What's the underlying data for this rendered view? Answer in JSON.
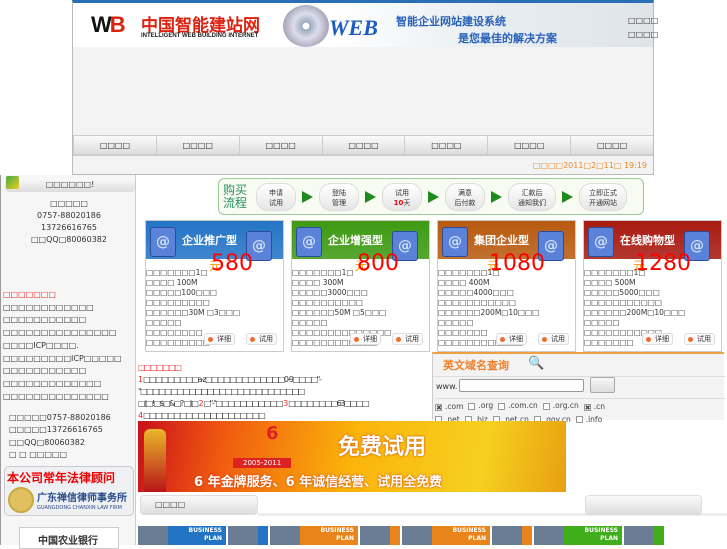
{
  "header": {
    "logo_mark": "WB",
    "logo_cn": "中国智能建站网",
    "logo_en": "INTELLIGENT WEB BUILDING INTERNET",
    "web_logo": "WEB",
    "slogan_1": "智能企业网站建设系统",
    "slogan_2": "是您最佳的解决方案",
    "top_links": [
      "□□□□",
      "□□□□"
    ],
    "nav": [
      "□□□□",
      "□□□□",
      "□□□□",
      "□□□□",
      "□□□□",
      "□□□□",
      "□□□□"
    ],
    "date": "□□□□2011□2□11□ 19:19"
  },
  "sidebar": {
    "title": "□□□□□□!",
    "contact": [
      "□□□□□",
      "0757-88020186",
      "13726616765",
      "□□QQ□80060382"
    ],
    "links": [
      "□□□□□□□",
      "□□□□□□□□□□□□",
      "□□□□□□□□□□□",
      "□□□□□□□□□□□□□□□",
      "□□□□ICP□□□□.",
      "□□□□□□□□□ICP□□□□□",
      "□□□□□□□□□□□",
      "□□□□□□□□□□□□□",
      "□□□□□□□□□□□□□□"
    ],
    "contact2": [
      "□□□□□0757-88020186",
      "□□□□□13726616765",
      "□□QQ□80060382",
      "□ □ □□□□□"
    ],
    "law_title": "本公司常年法律顾问",
    "law_firm": "广东禅信律师事务所",
    "law_firm_en": "GUANGDONG CHANXIN LAW FIRM",
    "bank": "中国农业银行"
  },
  "process": {
    "title": "购买流程",
    "steps": [
      [
        "申请",
        "试用"
      ],
      [
        "登陆",
        "管理"
      ],
      [
        "试用",
        "10",
        "天"
      ],
      [
        "满意",
        "后付款"
      ],
      [
        "汇款后",
        "通知我们"
      ],
      [
        "立即正式",
        "开通网站"
      ]
    ]
  },
  "cards": [
    {
      "name": "企业推广型",
      "color": "#2474c6",
      "currency": "元",
      "price": "580",
      "features": [
        "□□□□□□□1□",
        "□□□□ 100M",
        "□□□□□100□□□",
        "□□□□□□□□□",
        "□□□□□□30M □3□□□",
        "□□□□□",
        "□□□□□□□□",
        "□□□□□□□□□"
      ]
    },
    {
      "name": "企业增强型",
      "color": "#3d9a12",
      "currency": "元",
      "price": "800",
      "features": [
        "□□□□□□□1□",
        "□□□□ 300M",
        "□□□□□3000□□□",
        "□□□□□□□□□□",
        "□□□□□□50M □5□□□",
        "□□□□□",
        "□□□□□□□□□□□□□□",
        "□□□□□□□□□□□□"
      ]
    },
    {
      "name": "集团企业型",
      "color": "#b85a10",
      "currency": "元",
      "price": "1080",
      "features": [
        "□□□□□□□1□",
        "□□□□ 400M",
        "□□□□□4000□□□",
        "□□□□□□□□□□□",
        "□□□□□□200M□10□□□",
        "□□□□□",
        "□□□□□□□",
        "□□□□□□□□□□□□"
      ]
    },
    {
      "name": "在线购物型",
      "color": "#a81a10",
      "currency": "元",
      "price": "1280",
      "features": [
        "□□□□□□□1□",
        "□□□□ 500M",
        "□□□□□5000□□□",
        "□□□□□□□□□□□",
        "□□□□□□200M□10□□□",
        "□□□□□",
        "□□□□□□□□□□□",
        "□□□□□□□"
      ]
    }
  ],
  "card_buttons": {
    "detail": "详细",
    "trial": "试用"
  },
  "notice": {
    "title": "□□□□□□□",
    "n1": "1",
    "l1": "□□□□□□□□□a-z□□□□□□□□□□□□□0-9□□□□\"-\"□□□□□□□□□□□□□□□□□□□□□□□□□□□",
    "l2a": "□(□!□$□&□? □)□ ",
    "n2": "2",
    "l2b": "□\"-\"□□□□□□□□□□□ ",
    "n3": "3",
    "l2c": "□□□□□□□□63□□□□ ",
    "n4": "4",
    "l2d": "□□□□□□□□□□□□□□□□□□□□"
  },
  "domain": {
    "title": "英文域名查询",
    "prefix": "www.",
    "input_value": "",
    "button": "",
    "options": [
      {
        "label": ".com",
        "checked": true
      },
      {
        "label": ".org",
        "checked": false
      },
      {
        "label": ".com.cn",
        "checked": false
      },
      {
        "label": ".org.cn",
        "checked": false
      },
      {
        "label": ".cn",
        "checked": true
      },
      {
        "label": ".net",
        "checked": false
      },
      {
        "label": ".biz",
        "checked": false
      },
      {
        "label": ".net.cn",
        "checked": false
      },
      {
        "label": ".gov.cn",
        "checked": false
      },
      {
        "label": ".info",
        "checked": false
      }
    ]
  },
  "banner": {
    "six": "6",
    "years": "2005-2011",
    "headline": "免费试用",
    "sub": "6 年金牌服务、6 年诚信经营、试用全免费"
  },
  "bottom": {
    "bar_title": "□□□□",
    "plan_label_1": "BUSINESS",
    "plan_label_2": "PLAN"
  }
}
